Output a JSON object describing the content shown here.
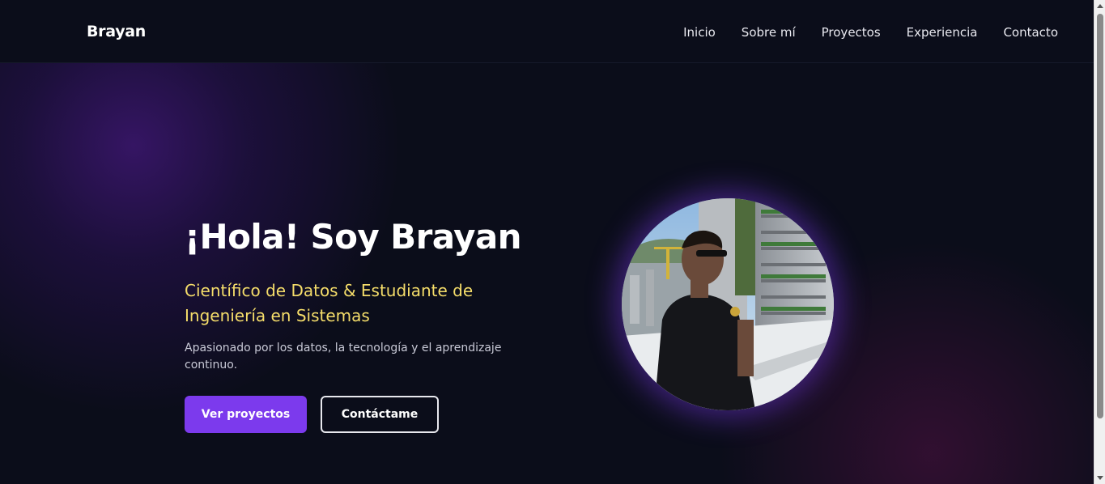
{
  "nav": {
    "brand": "Brayan",
    "links": [
      "Inicio",
      "Sobre mí",
      "Proyectos",
      "Experiencia",
      "Contacto"
    ]
  },
  "hero": {
    "title": "¡Hola! Soy Brayan",
    "subtitle": "Científico de Datos & Estudiante de Ingeniería en Sistemas",
    "description": "Apasionado por los datos, la tecnología y el aprendizaje continuo.",
    "primary_button": "Ver proyectos",
    "secondary_button": "Contáctame"
  },
  "colors": {
    "background": "#0b0d1a",
    "accent": "#7c3aed",
    "subtitle": "#f5dd6a"
  },
  "icons": {
    "profile_photo": "profile-photo"
  }
}
